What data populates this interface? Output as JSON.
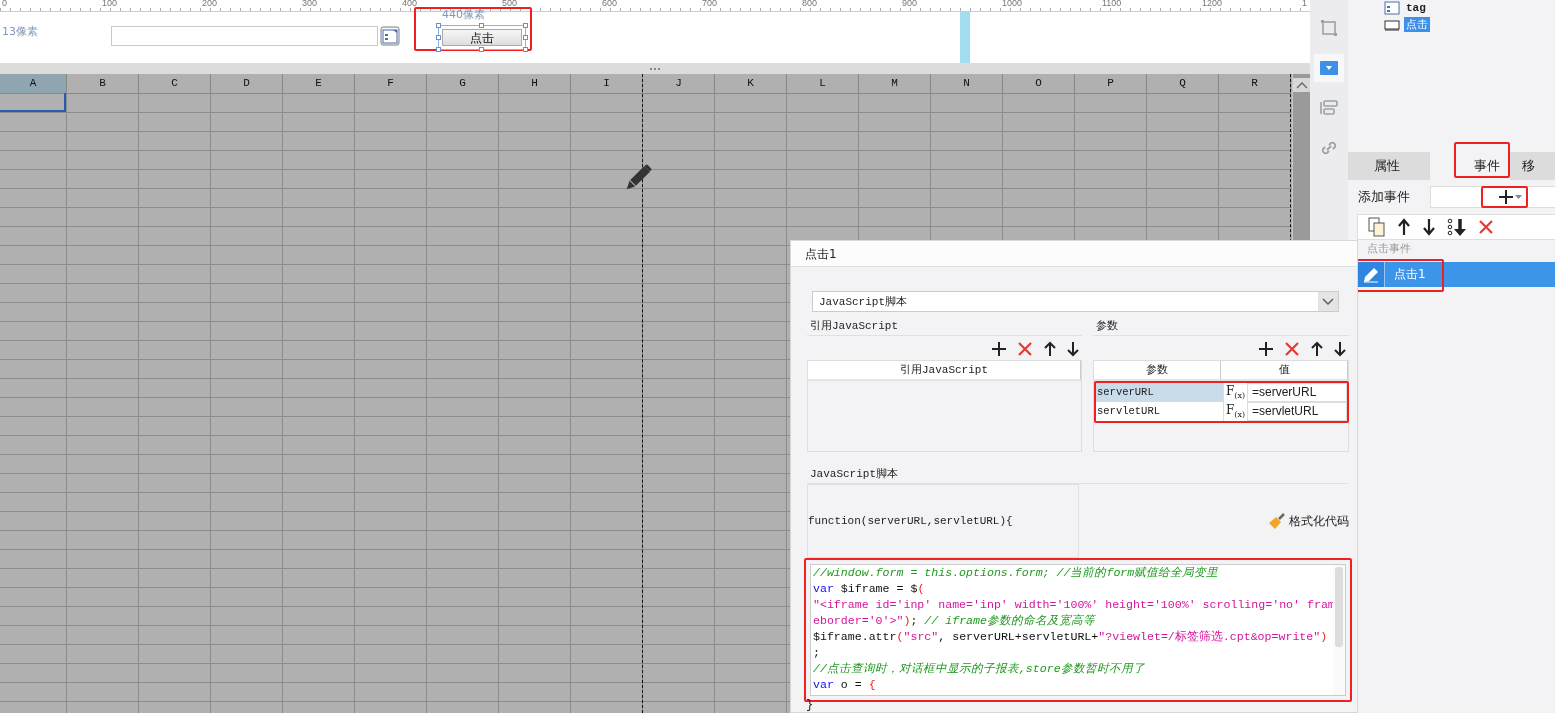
{
  "ruler": {
    "labels": [
      "0",
      "100",
      "200",
      "300",
      "400",
      "500",
      "600",
      "700",
      "800",
      "900",
      "1000",
      "1100",
      "1200",
      "1"
    ]
  },
  "canvas": {
    "size_label": "13像素",
    "button_size_label": "440像素",
    "button": {
      "label": "点击",
      "selected": true,
      "highlighted": true
    }
  },
  "sheet": {
    "columns": [
      {
        "label": "A",
        "selected": true
      },
      {
        "label": "B",
        "selected": false
      },
      {
        "label": "C",
        "selected": false
      },
      {
        "label": "D",
        "selected": false
      },
      {
        "label": "E",
        "selected": false
      },
      {
        "label": "F",
        "selected": false
      },
      {
        "label": "G",
        "selected": false
      },
      {
        "label": "H",
        "selected": false
      },
      {
        "label": "I",
        "selected": false
      },
      {
        "label": "J",
        "selected": false
      },
      {
        "label": "K",
        "selected": false
      },
      {
        "label": "L",
        "selected": false
      },
      {
        "label": "M",
        "selected": false
      },
      {
        "label": "N",
        "selected": false
      },
      {
        "label": "O",
        "selected": false
      },
      {
        "label": "P",
        "selected": false
      },
      {
        "label": "Q",
        "selected": false
      },
      {
        "label": "R",
        "selected": false
      }
    ]
  },
  "side_toolbar": [
    {
      "kind": "frame",
      "selected": false
    },
    {
      "kind": "dropdown",
      "selected": true
    },
    {
      "kind": "layout",
      "selected": false
    },
    {
      "kind": "link",
      "selected": false
    }
  ],
  "tree": [
    {
      "kind": "form",
      "label": "tag",
      "selected": false
    },
    {
      "kind": "button",
      "label": "点击",
      "selected": true
    }
  ],
  "tabs": [
    {
      "label": "属性",
      "selected": false,
      "highlighted": false
    },
    {
      "label": "事件",
      "selected": true,
      "highlighted": true
    },
    {
      "label": "移",
      "selected": false,
      "highlighted": false
    }
  ],
  "add_event": {
    "label": "添加事件",
    "highlighted": true
  },
  "event_list": {
    "group": "点击事件",
    "items": [
      {
        "label": "点击1",
        "selected": true,
        "highlighted": true
      }
    ]
  },
  "dialog": {
    "title": "点击1",
    "type_select": {
      "value": "JavaScript脚本"
    },
    "imports": {
      "title": "引用JavaScript",
      "column": "引用JavaScript"
    },
    "params": {
      "title": "参数",
      "columns": [
        "参数",
        "值"
      ],
      "highlighted": true,
      "rows": [
        {
          "name": "serverURL",
          "selected": true,
          "formula": "F$_{(x)}$",
          "value": "=serverURL"
        },
        {
          "name": "servletURL",
          "selected": false,
          "formula": "F$_{(x)}$",
          "value": "=servletURL"
        }
      ]
    },
    "script": {
      "title": "JavaScript脚本",
      "signature": "function(serverURL,servletURL){",
      "format_button": "格式化代码",
      "highlighted": true,
      "lines": [
        [
          {
            "kind": "comment",
            "text": "//window.form = this.options.form; //当前的form赋值给全局变里"
          }
        ],
        [
          {
            "kind": "keyword",
            "text": "var"
          },
          {
            "kind": "plain",
            "text": " $iframe = $"
          },
          {
            "kind": "punct",
            "text": "("
          }
        ],
        [
          {
            "kind": "string",
            "text": "\"<iframe id='inp' name='inp' width='100%' height='100%' scrolling='no' fram"
          }
        ],
        [
          {
            "kind": "string",
            "text": "eborder='0'>\""
          },
          {
            "kind": "punct",
            "text": ")"
          },
          {
            "kind": "plain",
            "text": "; "
          },
          {
            "kind": "comment",
            "text": "// iframe参数的命名及宽高等"
          }
        ],
        [
          {
            "kind": "plain",
            "text": "$iframe.attr"
          },
          {
            "kind": "punct",
            "text": "("
          },
          {
            "kind": "string",
            "text": "\"src\""
          },
          {
            "kind": "plain",
            "text": ", serverURL+servletURL+"
          },
          {
            "kind": "string",
            "text": "\"?viewlet=/标签筛选.cpt&op=write\""
          },
          {
            "kind": "punct",
            "text": ")"
          }
        ],
        [
          {
            "kind": "plain",
            "text": ";"
          }
        ],
        [
          {
            "kind": "comment",
            "text": "//点击查询时，对话框中显示的子报表,store参数暂时不用了"
          }
        ],
        [
          {
            "kind": "keyword",
            "text": "var"
          },
          {
            "kind": "plain",
            "text": " o = "
          },
          {
            "kind": "punct",
            "text": "{"
          }
        ]
      ],
      "closing": "}"
    }
  }
}
